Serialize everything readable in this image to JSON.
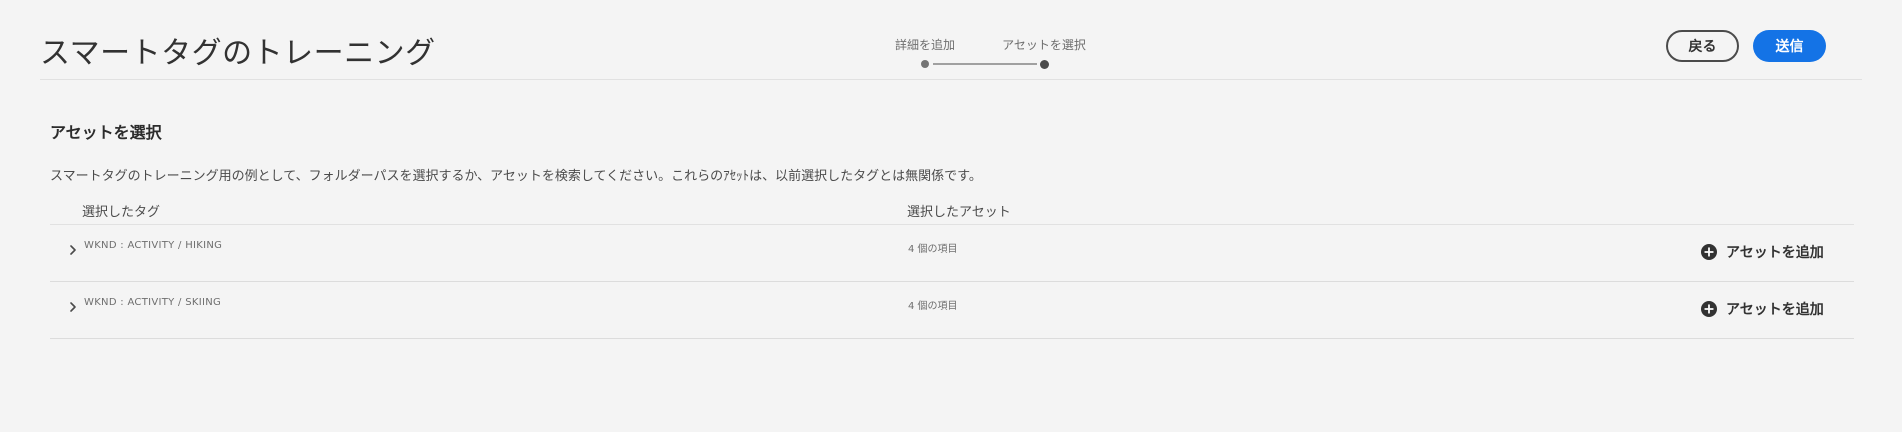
{
  "header": {
    "title": "スマートタグのトレーニング",
    "steps": [
      {
        "label": "詳細を追加",
        "state": "completed"
      },
      {
        "label": "アセットを選択",
        "state": "current"
      }
    ],
    "back_label": "戻る",
    "submit_label": "送信"
  },
  "section": {
    "title": "アセットを選択",
    "description": "スマートタグのトレーニング用の例として、フォルダーパスを選択するか、アセットを検索してください。これらのｱｾｯﾄは、以前選択したタグとは無関係です。"
  },
  "table": {
    "columns": [
      "選択したタグ",
      "選択したアセット"
    ],
    "rows": [
      {
        "tag": "WKND : ACTIVITY / HIKING",
        "count": "4 個の項目",
        "action": "アセットを追加"
      },
      {
        "tag": "WKND : ACTIVITY / SKIING",
        "count": "4 個の項目",
        "action": "アセットを追加"
      }
    ]
  },
  "icons": {
    "row_toggle": "chevron-right-icon",
    "add": "add-circle-icon"
  },
  "colors": {
    "accent": "#1473e6",
    "background": "#f4f4f4",
    "text": "#2c2c2c"
  }
}
